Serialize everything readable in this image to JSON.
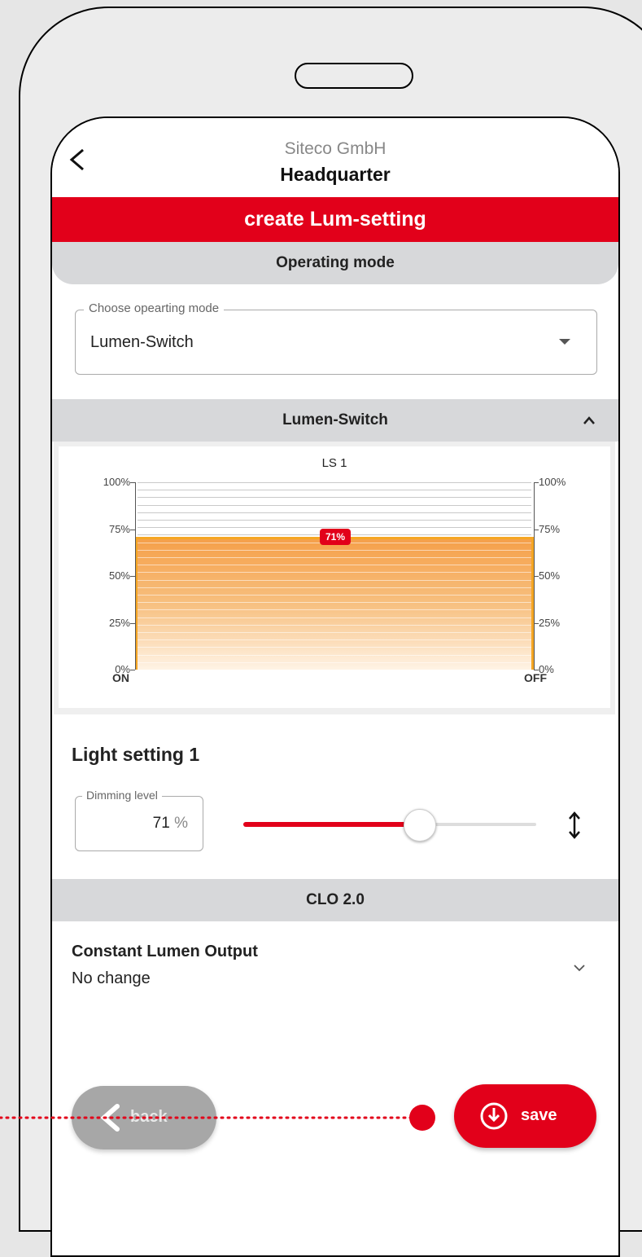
{
  "header": {
    "company": "Siteco GmbH",
    "site": "Headquarter"
  },
  "title_bar": "create Lum-setting",
  "operating_mode": {
    "section_title": "Operating mode",
    "field_label": "Choose opearting mode",
    "value": "Lumen-Switch"
  },
  "lumen_switch": {
    "section_title": "Lumen-Switch"
  },
  "chart_data": {
    "type": "area",
    "title": "LS 1",
    "x_labels": [
      "ON",
      "OFF"
    ],
    "y_ticks": [
      "100%",
      "75%",
      "50%",
      "25%",
      "0%"
    ],
    "ylim": [
      0,
      100
    ],
    "value": 71,
    "value_label": "71%",
    "fill_color": "#f5a623"
  },
  "light_setting": {
    "title": "Light setting 1",
    "dimming_label": "Dimming level",
    "dimming_value": "71",
    "dimming_unit": "%",
    "slider_fraction": 0.6
  },
  "clo": {
    "section_title": "CLO 2.0",
    "title": "Constant Lumen Output",
    "value": "No change"
  },
  "buttons": {
    "back": "back",
    "save": "save"
  },
  "colors": {
    "accent": "#e2001a",
    "section_gray": "#d7d8da",
    "back_button": "#a7a7a7"
  }
}
